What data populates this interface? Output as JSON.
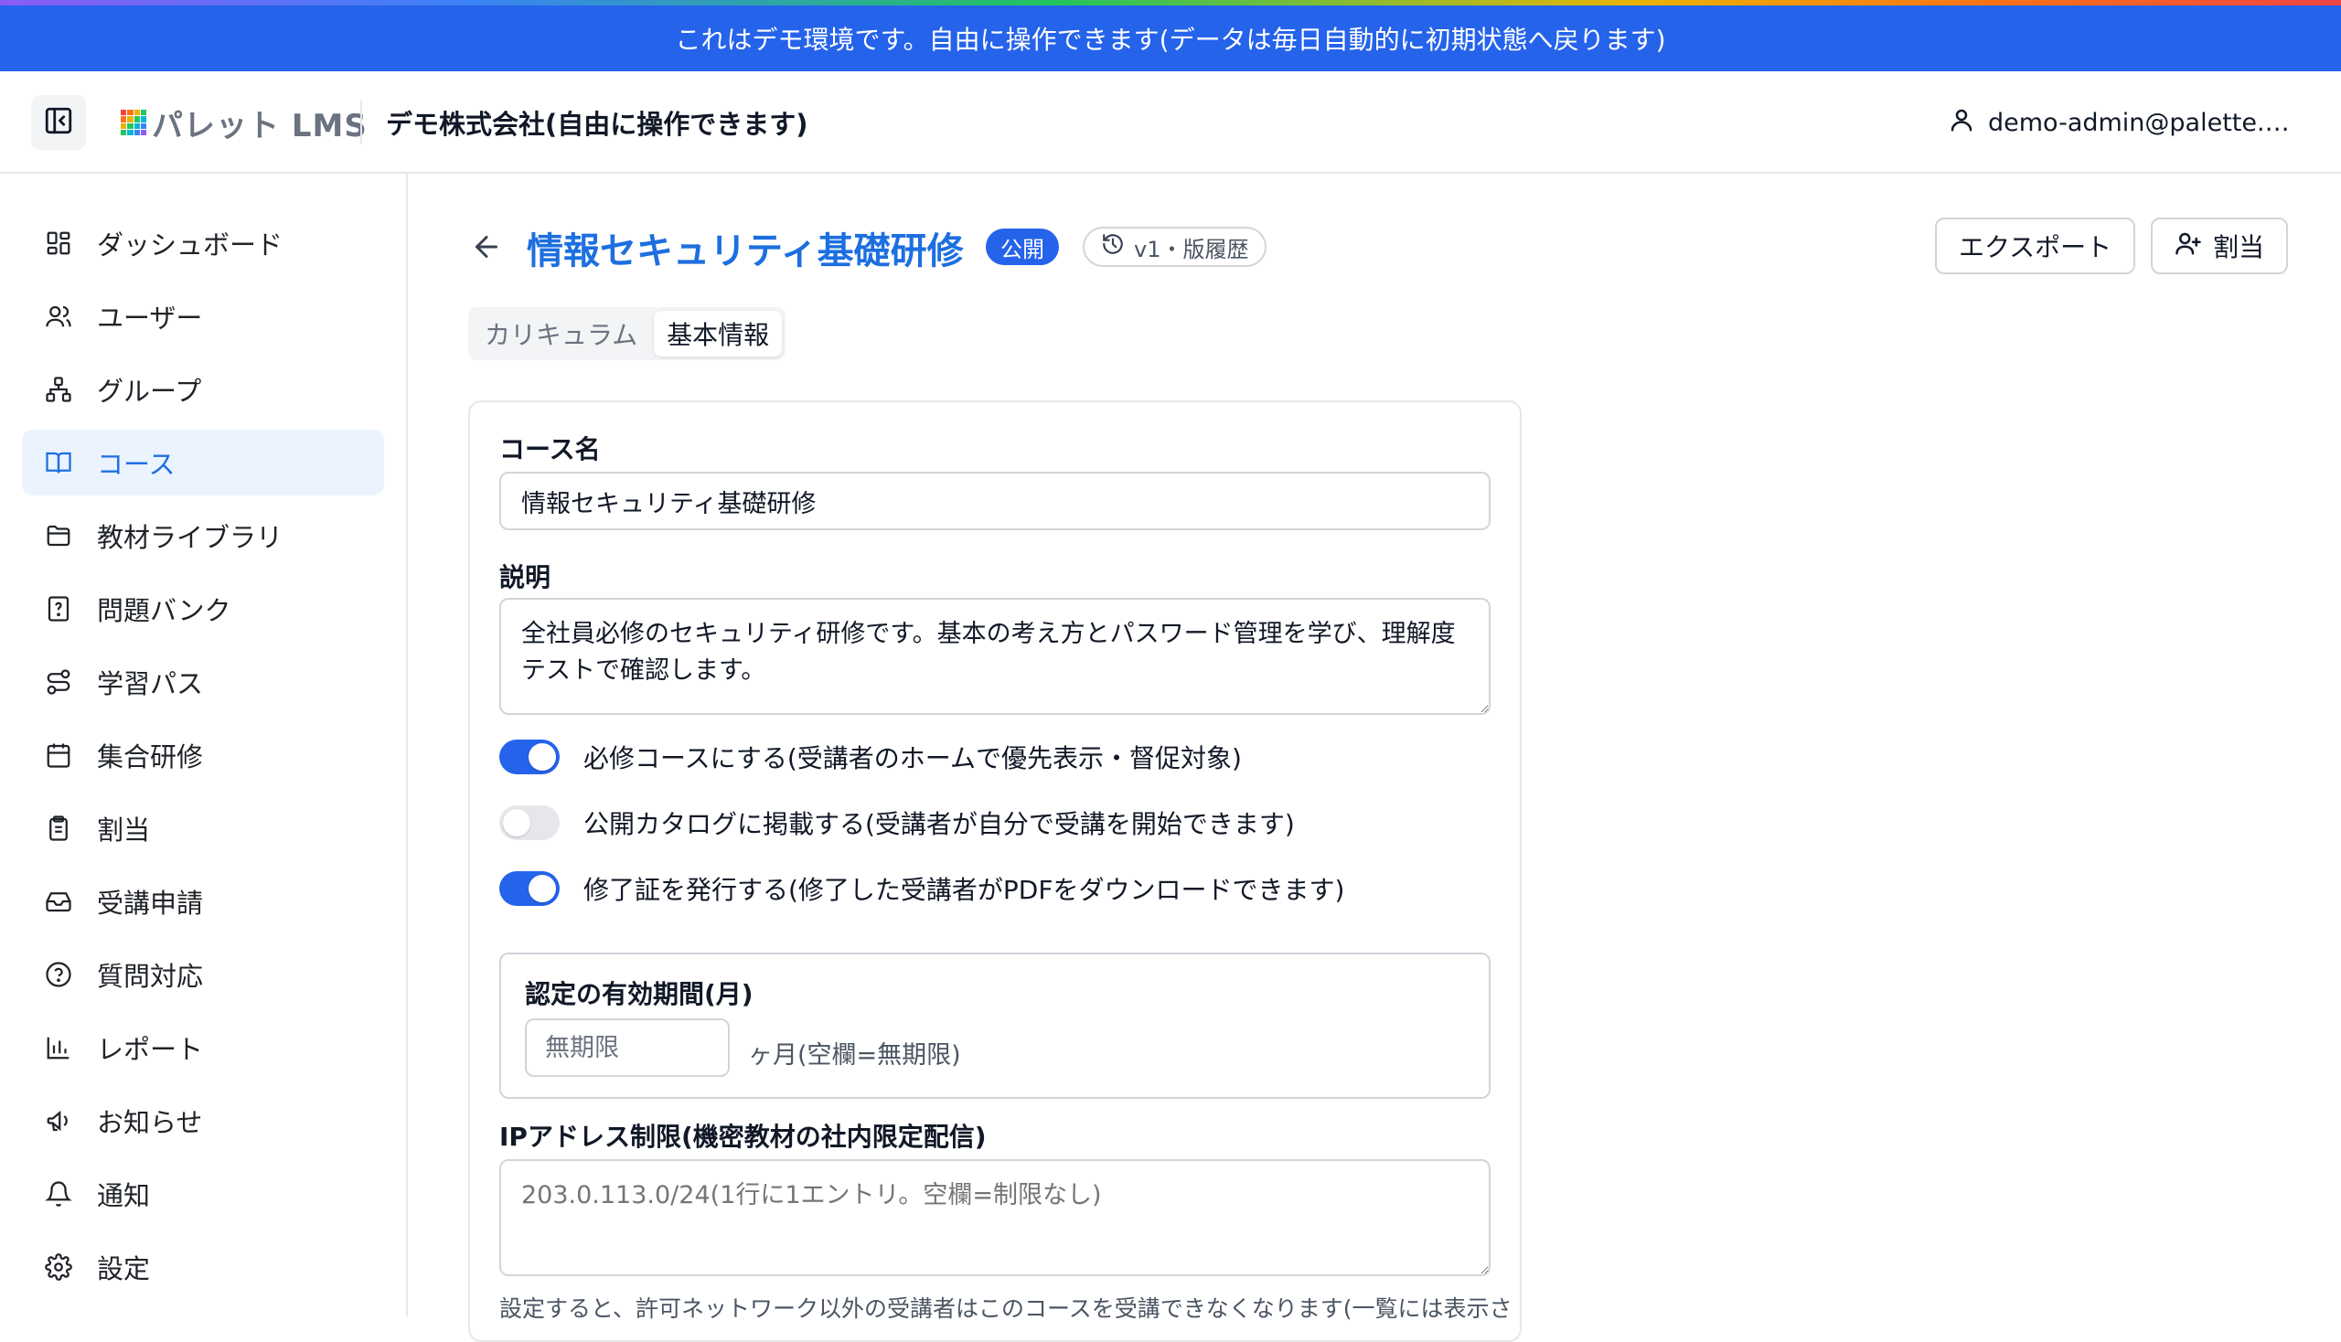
{
  "banner": {
    "text": "これはデモ環境です。自由に操作できます(データは毎日自動的に初期状態へ戻ります)"
  },
  "topbar": {
    "logo_text": "パレット LMS",
    "org_name": "デモ株式会社(自由に操作できます)",
    "user_email": "demo-admin@palette.e…"
  },
  "sidebar": {
    "items": [
      {
        "label": "ダッシュボード",
        "icon": "dashboard-icon",
        "active": false
      },
      {
        "label": "ユーザー",
        "icon": "users-icon",
        "active": false
      },
      {
        "label": "グループ",
        "icon": "group-icon",
        "active": false
      },
      {
        "label": "コース",
        "icon": "book-icon",
        "active": true
      },
      {
        "label": "教材ライブラリ",
        "icon": "folder-icon",
        "active": false
      },
      {
        "label": "問題バンク",
        "icon": "question-file-icon",
        "active": false
      },
      {
        "label": "学習パス",
        "icon": "route-icon",
        "active": false
      },
      {
        "label": "集合研修",
        "icon": "calendar-icon",
        "active": false
      },
      {
        "label": "割当",
        "icon": "clipboard-icon",
        "active": false
      },
      {
        "label": "受講申請",
        "icon": "inbox-icon",
        "active": false
      },
      {
        "label": "質問対応",
        "icon": "help-circle-icon",
        "active": false
      },
      {
        "label": "レポート",
        "icon": "bar-chart-icon",
        "active": false
      },
      {
        "label": "お知らせ",
        "icon": "megaphone-icon",
        "active": false
      },
      {
        "label": "通知",
        "icon": "bell-icon",
        "active": false
      },
      {
        "label": "設定",
        "icon": "gear-icon",
        "active": false
      }
    ]
  },
  "header": {
    "title": "情報セキュリティ基礎研修",
    "status_badge": "公開",
    "version_label": "v1・版履歴",
    "export_label": "エクスポート",
    "assign_label": "割当"
  },
  "tabs": [
    {
      "label": "カリキュラム",
      "active": false
    },
    {
      "label": "基本情報",
      "active": true
    }
  ],
  "form": {
    "course_name_label": "コース名",
    "course_name_value": "情報セキュリティ基礎研修",
    "description_label": "説明",
    "description_value": "全社員必修のセキュリティ研修です。基本の考え方とパスワード管理を学び、理解度テストで確認します。",
    "toggles": [
      {
        "label": "必修コースにする(受講者のホームで優先表示・督促対象)",
        "on": true
      },
      {
        "label": "公開カタログに掲載する(受講者が自分で受講を開始できます)",
        "on": false
      },
      {
        "label": "修了証を発行する(修了した受講者がPDFをダウンロードできます)",
        "on": true
      }
    ],
    "validity_label": "認定の有効期間(月)",
    "validity_placeholder": "無期限",
    "validity_unit": "ヶ月(空欄=無期限)",
    "ip_label": "IPアドレス制限(機密教材の社内限定配信)",
    "ip_placeholder": "203.0.113.0/24(1行に1エントリ。空欄=制限なし)",
    "ip_help": "設定すると、許可ネットワーク以外の受講者はこのコースを受講できなくなります(一覧には表示さ"
  },
  "colors": {
    "accent": "#2563eb",
    "active_nav_bg": "#eaf3fe",
    "active_nav_text": "#1d6fe0",
    "title_color": "#1d6fe0"
  }
}
